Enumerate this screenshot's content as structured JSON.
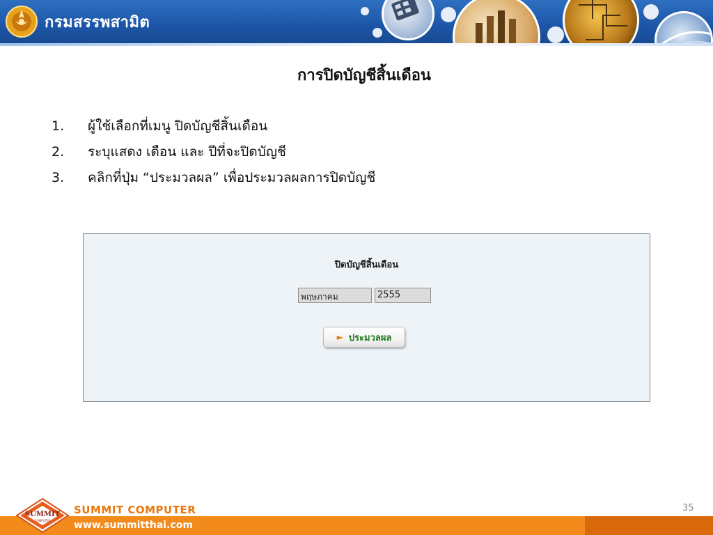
{
  "header": {
    "org_name": "กรมสรรพสามิต",
    "emblem_icon": "garuda-emblem-icon",
    "colors": {
      "banner": "#1d56a8"
    }
  },
  "slide": {
    "title": "การปิดบัญชีสิ้นเดือน",
    "steps": [
      {
        "num": "1.",
        "text": "ผู้ใช้เลือกที่เมนู ปิดบัญชีสิ้นเดือน"
      },
      {
        "num": "2.",
        "text": "ระบุแสดง เดือน และ ปีที่จะปิดบัญชี"
      },
      {
        "num": "3.",
        "text": "คลิกที่ปุ่ม “ประมวลผล” เพื่อประมวลผลการปิดบัญชี"
      }
    ]
  },
  "app_panel": {
    "title": "ปิดบัญชีสิ้นเดือน",
    "month_value": "พฤษภาคม",
    "year_value": "2555",
    "process_button_label": "ประมวลผล",
    "process_button_icon": "arrow-right-icon"
  },
  "footer": {
    "company_name": "SUMMIT  COMPUTER",
    "website": "www.summitthai.com",
    "logo_text": "SUMMIT",
    "logo_subtext": "COMPUTER",
    "page_number": "35",
    "colors": {
      "bar": "#f28a1c",
      "company_text": "#e8780f"
    }
  }
}
